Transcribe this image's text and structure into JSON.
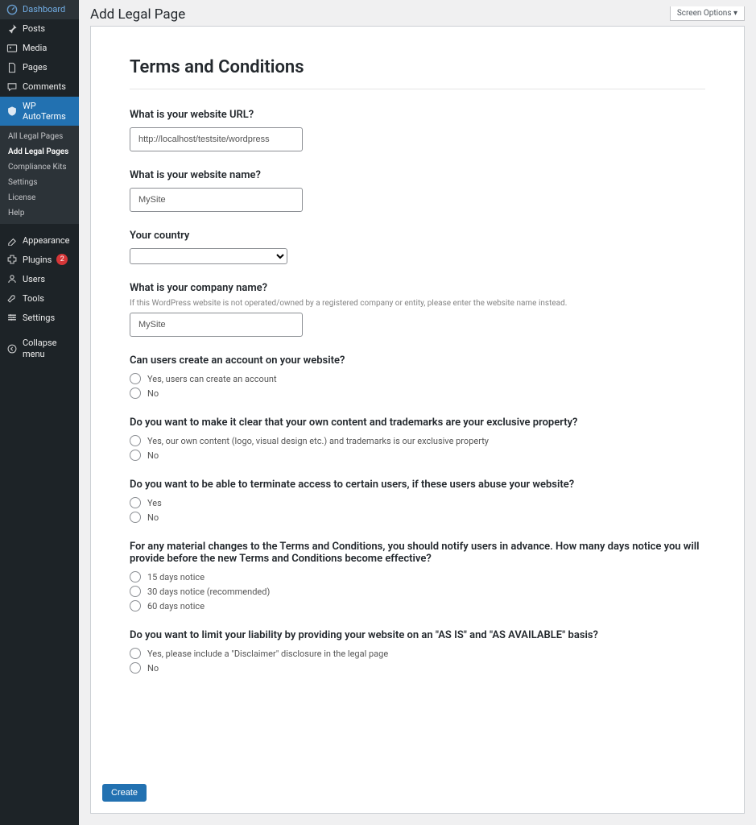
{
  "sidebar": {
    "items": [
      {
        "icon": "dashboard",
        "label": "Dashboard"
      },
      {
        "icon": "pin",
        "label": "Posts"
      },
      {
        "icon": "media",
        "label": "Media"
      },
      {
        "icon": "page",
        "label": "Pages"
      },
      {
        "icon": "comment",
        "label": "Comments"
      },
      {
        "icon": "shield",
        "label": "WP AutoTerms",
        "active": true
      }
    ],
    "subitems": [
      {
        "label": "All Legal Pages"
      },
      {
        "label": "Add Legal Pages",
        "current": true
      },
      {
        "label": "Compliance Kits"
      },
      {
        "label": "Settings"
      },
      {
        "label": "License"
      },
      {
        "label": "Help"
      }
    ],
    "items2": [
      {
        "icon": "appearance",
        "label": "Appearance"
      },
      {
        "icon": "plugin",
        "label": "Plugins",
        "badge": "2"
      },
      {
        "icon": "users",
        "label": "Users"
      },
      {
        "icon": "tools",
        "label": "Tools"
      },
      {
        "icon": "settings",
        "label": "Settings"
      }
    ],
    "collapse_label": "Collapse menu"
  },
  "header": {
    "page_title": "Add Legal Page",
    "screen_options": "Screen Options ▾"
  },
  "form": {
    "title": "Terms and Conditions",
    "url_label": "What is your website URL?",
    "url_value": "http://localhost/testsite/wordpress",
    "name_label": "What is your website name?",
    "name_value": "MySite",
    "country_label": "Your country",
    "company_label": "What is your company name?",
    "company_help": "If this WordPress website is not operated/owned by a registered company or entity, please enter the website name instead.",
    "company_value": "MySite",
    "accounts_label": "Can users create an account on your website?",
    "accounts_yes": "Yes, users can create an account",
    "accounts_no": "No",
    "trademark_label": "Do you want to make it clear that your own content and trademarks are your exclusive property?",
    "trademark_yes": "Yes, our own content (logo, visual design etc.) and trademarks is our exclusive property",
    "trademark_no": "No",
    "terminate_label": "Do you want to be able to terminate access to certain users, if these users abuse your website?",
    "terminate_yes": "Yes",
    "terminate_no": "No",
    "notice_label": "For any material changes to the Terms and Conditions, you should notify users in advance. How many days notice you will provide before the new Terms and Conditions become effective?",
    "notice_15": "15 days notice",
    "notice_30": "30 days notice (recommended)",
    "notice_60": "60 days notice",
    "liability_label": "Do you want to limit your liability by providing your website on an \"AS IS\" and \"AS AVAILABLE\" basis?",
    "liability_yes": "Yes, please include a \"Disclaimer\" disclosure in the legal page",
    "liability_no": "No",
    "create_button": "Create"
  }
}
